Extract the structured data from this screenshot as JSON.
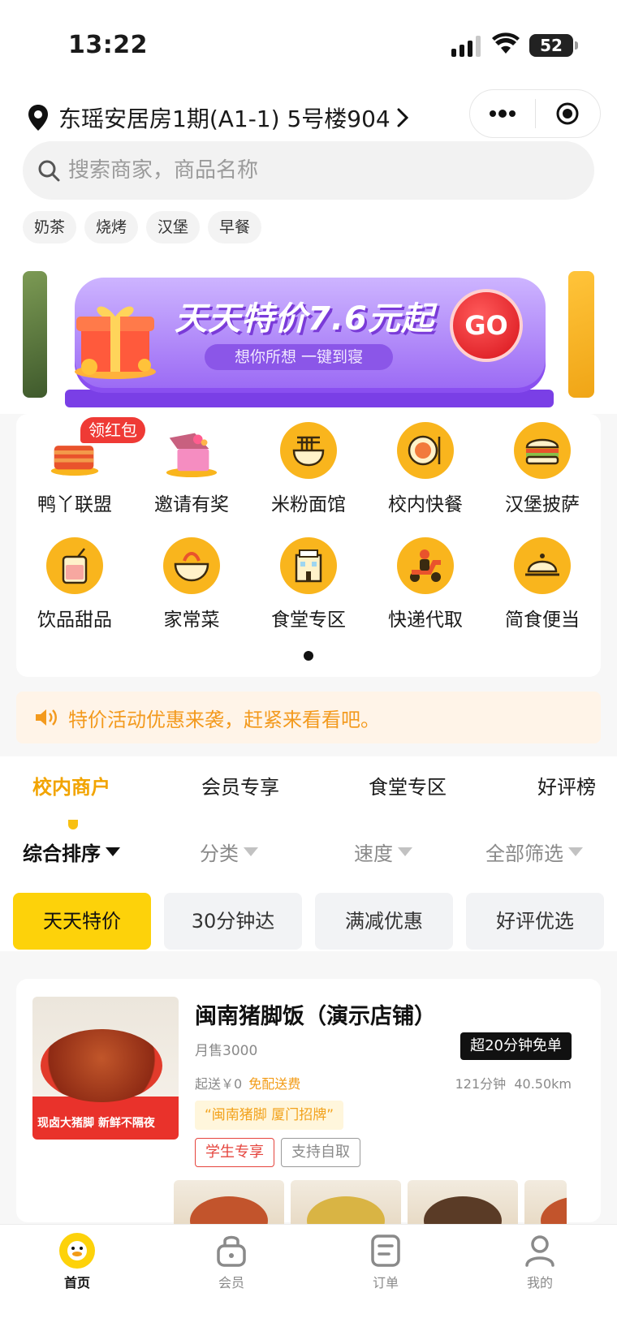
{
  "status_bar": {
    "time": "13:22",
    "battery": "52"
  },
  "header": {
    "address": "东瑶安居房1期(A1-1) 5号楼904",
    "search_placeholder": "搜索商家，商品名称",
    "tags": [
      "奶茶",
      "烧烤",
      "汉堡",
      "早餐"
    ]
  },
  "banner": {
    "title": "天天特价7.6元起",
    "subtitle": "想你所想 一键到寝",
    "go_label": "GO"
  },
  "categories": [
    {
      "label": "鸭丫联盟",
      "badge": "领红包",
      "icon": "duck-meal-icon"
    },
    {
      "label": "邀请有奖",
      "icon": "gift-box-icon"
    },
    {
      "label": "米粉面馆",
      "icon": "noodle-bowl-icon"
    },
    {
      "label": "校内快餐",
      "icon": "plate-meal-icon"
    },
    {
      "label": "汉堡披萨",
      "icon": "burger-icon"
    },
    {
      "label": "饮品甜品",
      "icon": "drink-cup-icon"
    },
    {
      "label": "家常菜",
      "icon": "home-dish-icon"
    },
    {
      "label": "食堂专区",
      "icon": "canteen-building-icon"
    },
    {
      "label": "快递代取",
      "icon": "delivery-scooter-icon"
    },
    {
      "label": "简食便当",
      "icon": "cloche-icon"
    }
  ],
  "notice": {
    "text": "特价活动优惠来袭，赶紧来看看吧。"
  },
  "tabs": [
    "校内商户",
    "会员专享",
    "食堂专区",
    "好评榜"
  ],
  "sort": [
    "综合排序",
    "分类",
    "速度",
    "全部筛选"
  ],
  "chips": [
    "天天特价",
    "30分钟达",
    "满减优惠",
    "好评优选"
  ],
  "store": {
    "name": "闽南猪脚饭（演示店铺）",
    "sales": "月售3000",
    "promo": "超20分钟免单",
    "min_order": "起送￥0",
    "delivery": "免配送费",
    "eta": "121分钟",
    "distance": "40.50km",
    "slogan": "“闽南猪脚 厦门招牌”",
    "tags": [
      "学生专享",
      "支持自取"
    ],
    "image_caption": "现卤大猪脚 新鲜不隔夜"
  },
  "tabbar": [
    "首页",
    "会员",
    "订单",
    "我的"
  ],
  "colors": {
    "accent": "#fdd20a",
    "active_tab": "#f2a400",
    "notice_text": "#f39a1e",
    "badge_red": "#ef3a35"
  }
}
